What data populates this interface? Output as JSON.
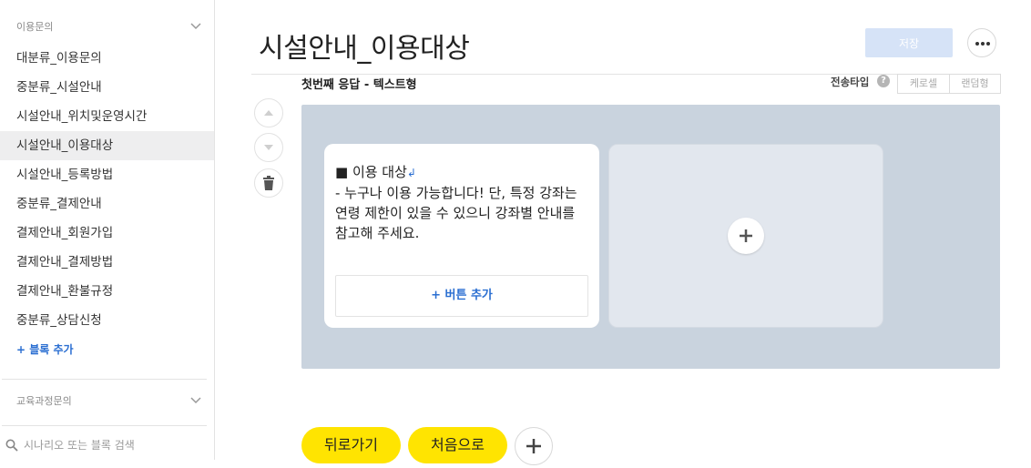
{
  "sidebar": {
    "group1_label": "이용문의",
    "items": [
      "대분류_이용문의",
      "중분류_시설안내",
      "시설안내_위치및운영시간",
      "시설안내_이용대상",
      "시설안내_등록방법",
      "중분류_결제안내",
      "결제안내_회원가입",
      "결제안내_결제방법",
      "결제안내_환불규정",
      "중분류_상담신청"
    ],
    "active_index": 3,
    "add_block_label": "+ 블록 추가",
    "group2_label": "교육과정문의",
    "search_placeholder": "시나리오 또는 블록 검색"
  },
  "header": {
    "title": "시설안내_이용대상",
    "save_label": "저장"
  },
  "response": {
    "label": "첫번째 응답 - 텍스트형",
    "send_type_label": "전송타입",
    "help_glyph": "?",
    "types": [
      "케로셀",
      "랜덤형"
    ]
  },
  "card": {
    "line1": "■ 이용 대상",
    "return_glyph": "↲",
    "body": "- 누구나 이용 가능합니다! 단, 특정 강좌는 연령 제한이 있을 수 있으니 강좌별 안내를 참고해 주세요.",
    "button_label": "+ 버튼 추가"
  },
  "footer": {
    "back_label": "뒤로가기",
    "home_label": "처음으로"
  },
  "colors": {
    "accent": "#2a6ed1",
    "canvas_bg": "#c9d3de",
    "pill_yellow": "#ffe401",
    "save_disabled": "#d6e3f7"
  }
}
